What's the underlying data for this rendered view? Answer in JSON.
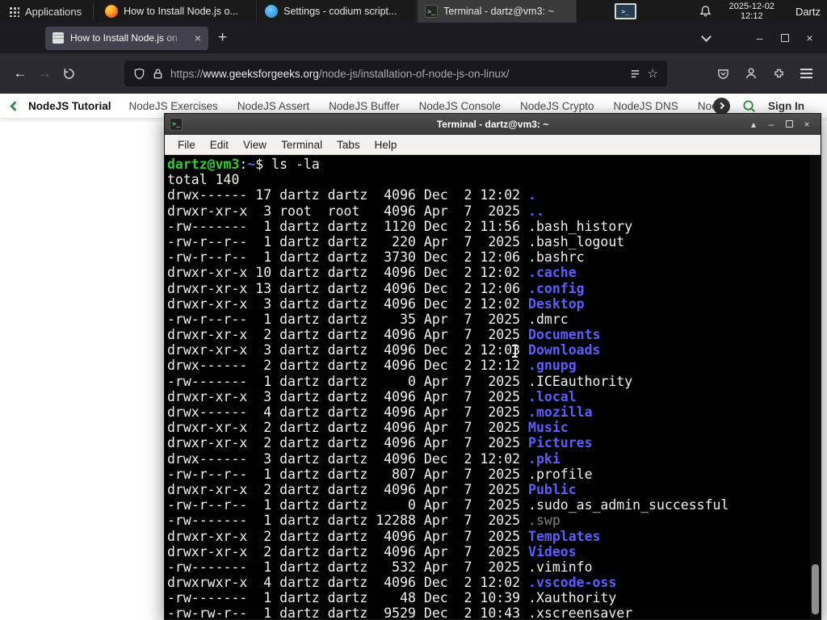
{
  "panel": {
    "applications_label": "Applications",
    "window_buttons": [
      {
        "title": "How to Install Node.js o...",
        "icon": "firefox",
        "active": false
      },
      {
        "title": "Settings - codium script...",
        "icon": "codium",
        "active": false
      },
      {
        "title": "Terminal - dartz@vm3: ~",
        "icon": "terminal",
        "active": true
      }
    ],
    "clock": {
      "date": "2025-12-02",
      "time": "12:12"
    },
    "user_label": "Dartz"
  },
  "icons": {
    "terminal_glyph": ">_"
  },
  "browser": {
    "tab": {
      "title": "How to Install Node.js on",
      "close": "×"
    },
    "new_tab_button": "+",
    "nav": {
      "back": "←",
      "forward": "→"
    },
    "window_controls": {
      "minimize": "–",
      "close": "×"
    },
    "url": {
      "scheme": "https://",
      "domain": "www.geeksforgeeks.org",
      "path": "/node-js/installation-of-node-js-on-linux/"
    },
    "star_glyph": "☆"
  },
  "site_nav": {
    "active_item": "NodeJS Tutorial",
    "items": [
      "NodeJS Exercises",
      "NodeJS Assert",
      "NodeJS Buffer",
      "NodeJS Console",
      "NodeJS Crypto",
      "NodeJS DNS",
      "Node"
    ],
    "sign_in_label": "Sign In",
    "accent_green": "#2f8d46"
  },
  "terminal": {
    "window_title": "Terminal - dartz@vm3: ~",
    "menu_items": [
      "File",
      "Edit",
      "View",
      "Terminal",
      "Tabs",
      "Help"
    ],
    "controls": {
      "shade": "▴",
      "minimize": "–",
      "close": "×"
    },
    "prompt": {
      "user_host": "dartz@vm3",
      "separator": ":",
      "cwd": "~",
      "symbol": "$ ",
      "command": "ls -la"
    },
    "total_line": "total 140",
    "colors": {
      "prompt_green": "#33cc33",
      "dir_blue": "#5c5cff",
      "dim_gray": "#808080",
      "fg": "#f0f0f0",
      "bg": "#000000"
    },
    "listing": [
      {
        "meta": "drwx------ 17 dartz dartz  4096 Dec  2 12:02 ",
        "name": ".",
        "kind": "dir"
      },
      {
        "meta": "drwxr-xr-x  3 root  root   4096 Apr  7  2025 ",
        "name": "..",
        "kind": "dir"
      },
      {
        "meta": "-rw-------  1 dartz dartz  1120 Dec  2 11:56 ",
        "name": ".bash_history",
        "kind": "file"
      },
      {
        "meta": "-rw-r--r--  1 dartz dartz   220 Apr  7  2025 ",
        "name": ".bash_logout",
        "kind": "file"
      },
      {
        "meta": "-rw-r--r--  1 dartz dartz  3730 Dec  2 12:06 ",
        "name": ".bashrc",
        "kind": "file"
      },
      {
        "meta": "drwxr-xr-x 10 dartz dartz  4096 Dec  2 12:02 ",
        "name": ".cache",
        "kind": "dir"
      },
      {
        "meta": "drwxr-xr-x 13 dartz dartz  4096 Dec  2 12:06 ",
        "name": ".config",
        "kind": "dir"
      },
      {
        "meta": "drwxr-xr-x  3 dartz dartz  4096 Dec  2 12:02 ",
        "name": "Desktop",
        "kind": "dir"
      },
      {
        "meta": "-rw-r--r--  1 dartz dartz    35 Apr  7  2025 ",
        "name": ".dmrc",
        "kind": "file"
      },
      {
        "meta": "drwxr-xr-x  2 dartz dartz  4096 Apr  7  2025 ",
        "name": "Documents",
        "kind": "dir"
      },
      {
        "meta": "drwxr-xr-x  3 dartz dartz  4096 Dec  2 12:03 ",
        "name": "Downloads",
        "kind": "dir"
      },
      {
        "meta": "drwx------  2 dartz dartz  4096 Dec  2 12:12 ",
        "name": ".gnupg",
        "kind": "dir"
      },
      {
        "meta": "-rw-------  1 dartz dartz     0 Apr  7  2025 ",
        "name": ".ICEauthority",
        "kind": "file"
      },
      {
        "meta": "drwxr-xr-x  3 dartz dartz  4096 Apr  7  2025 ",
        "name": ".local",
        "kind": "dir"
      },
      {
        "meta": "drwx------  4 dartz dartz  4096 Apr  7  2025 ",
        "name": ".mozilla",
        "kind": "dir"
      },
      {
        "meta": "drwxr-xr-x  2 dartz dartz  4096 Apr  7  2025 ",
        "name": "Music",
        "kind": "dir"
      },
      {
        "meta": "drwxr-xr-x  2 dartz dartz  4096 Apr  7  2025 ",
        "name": "Pictures",
        "kind": "dir"
      },
      {
        "meta": "drwx------  3 dartz dartz  4096 Dec  2 12:02 ",
        "name": ".pki",
        "kind": "dir"
      },
      {
        "meta": "-rw-r--r--  1 dartz dartz   807 Apr  7  2025 ",
        "name": ".profile",
        "kind": "file"
      },
      {
        "meta": "drwxr-xr-x  2 dartz dartz  4096 Apr  7  2025 ",
        "name": "Public",
        "kind": "dir"
      },
      {
        "meta": "-rw-r--r--  1 dartz dartz     0 Apr  7  2025 ",
        "name": ".sudo_as_admin_successful",
        "kind": "file"
      },
      {
        "meta": "-rw-------  1 dartz dartz 12288 Apr  7  2025 ",
        "name": ".swp",
        "kind": "dim"
      },
      {
        "meta": "drwxr-xr-x  2 dartz dartz  4096 Apr  7  2025 ",
        "name": "Templates",
        "kind": "dir"
      },
      {
        "meta": "drwxr-xr-x  2 dartz dartz  4096 Apr  7  2025 ",
        "name": "Videos",
        "kind": "dir"
      },
      {
        "meta": "-rw-------  1 dartz dartz   532 Apr  7  2025 ",
        "name": ".viminfo",
        "kind": "file"
      },
      {
        "meta": "drwxrwxr-x  4 dartz dartz  4096 Dec  2 12:02 ",
        "name": ".vscode-oss",
        "kind": "dir"
      },
      {
        "meta": "-rw-------  1 dartz dartz    48 Dec  2 10:39 ",
        "name": ".Xauthority",
        "kind": "file"
      },
      {
        "meta": "-rw-rw-r--  1 dartz dartz  9529 Dec  2 10:43 ",
        "name": ".xscreensaver",
        "kind": "file"
      }
    ]
  }
}
